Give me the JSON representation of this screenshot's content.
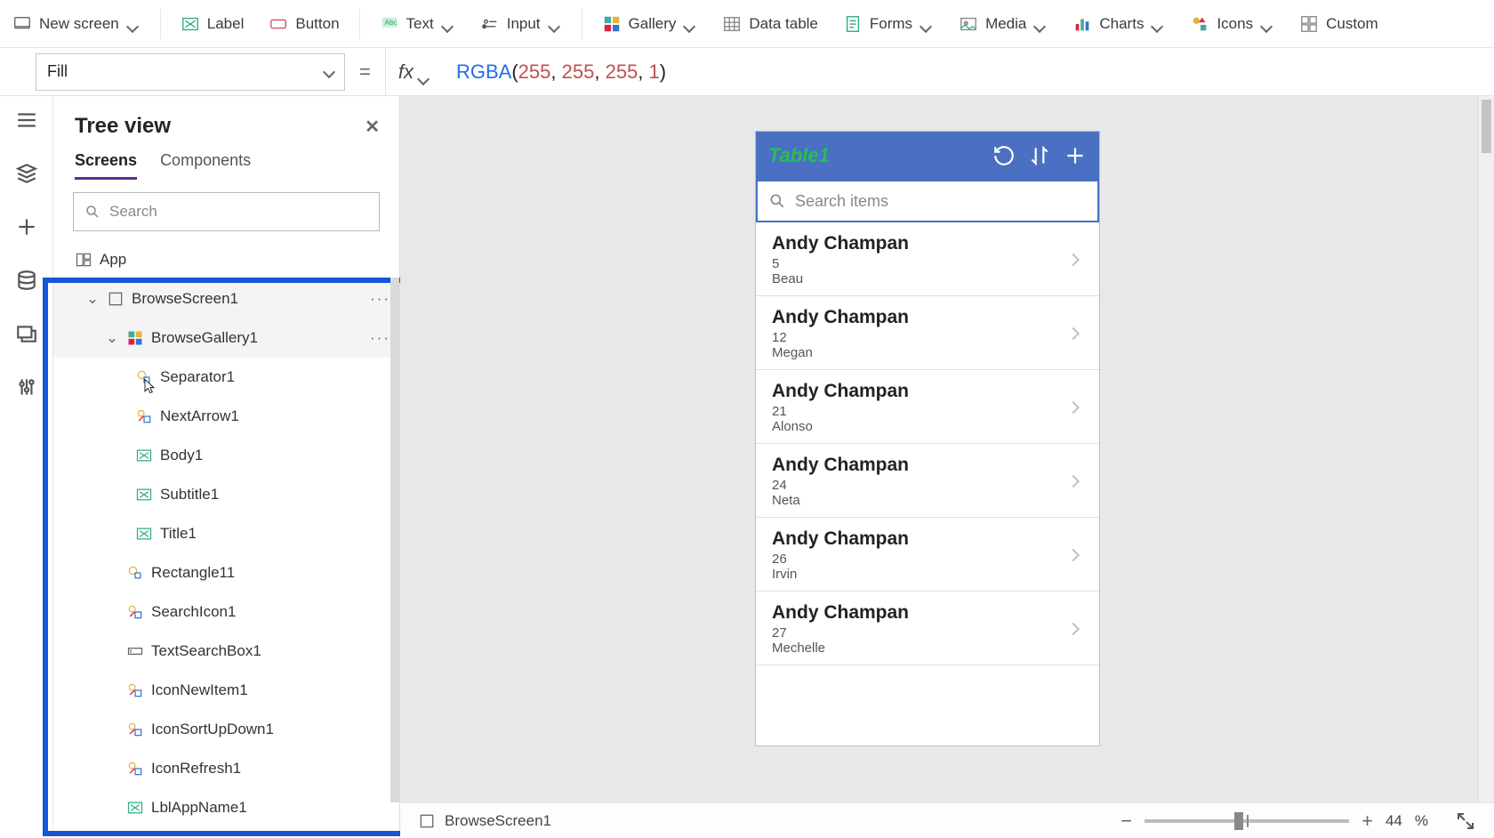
{
  "ribbon": {
    "new_screen": "New screen",
    "label": "Label",
    "button": "Button",
    "text": "Text",
    "input": "Input",
    "gallery": "Gallery",
    "data_table": "Data table",
    "forms": "Forms",
    "media": "Media",
    "charts": "Charts",
    "icons": "Icons",
    "custom": "Custom"
  },
  "formula": {
    "property": "Fill",
    "fx": "fx",
    "fn": "RGBA",
    "args": [
      "255",
      "255",
      "255",
      "1"
    ]
  },
  "tree": {
    "title": "Tree view",
    "tabs": {
      "screens": "Screens",
      "components": "Components"
    },
    "search_placeholder": "Search",
    "app": "App",
    "browse_screen": "BrowseScreen1",
    "browse_gallery": "BrowseGallery1",
    "items": {
      "separator": "Separator1",
      "next_arrow": "NextArrow1",
      "body": "Body1",
      "subtitle": "Subtitle1",
      "title": "Title1",
      "rectangle": "Rectangle11",
      "search_icon": "SearchIcon1",
      "text_search": "TextSearchBox1",
      "icon_new": "IconNewItem1",
      "icon_sort": "IconSortUpDown1",
      "icon_refresh": "IconRefresh1",
      "lbl_app": "LblAppName1"
    }
  },
  "phone": {
    "title": "Table1",
    "search_placeholder": "Search items",
    "rows": [
      {
        "name": "Andy Champan",
        "num": "5",
        "sub": "Beau"
      },
      {
        "name": "Andy Champan",
        "num": "12",
        "sub": "Megan"
      },
      {
        "name": "Andy Champan",
        "num": "21",
        "sub": "Alonso"
      },
      {
        "name": "Andy Champan",
        "num": "24",
        "sub": "Neta"
      },
      {
        "name": "Andy Champan",
        "num": "26",
        "sub": "Irvin"
      },
      {
        "name": "Andy Champan",
        "num": "27",
        "sub": "Mechelle"
      }
    ]
  },
  "status": {
    "selected": "BrowseScreen1",
    "zoom_value": "44",
    "zoom_unit": "%"
  }
}
